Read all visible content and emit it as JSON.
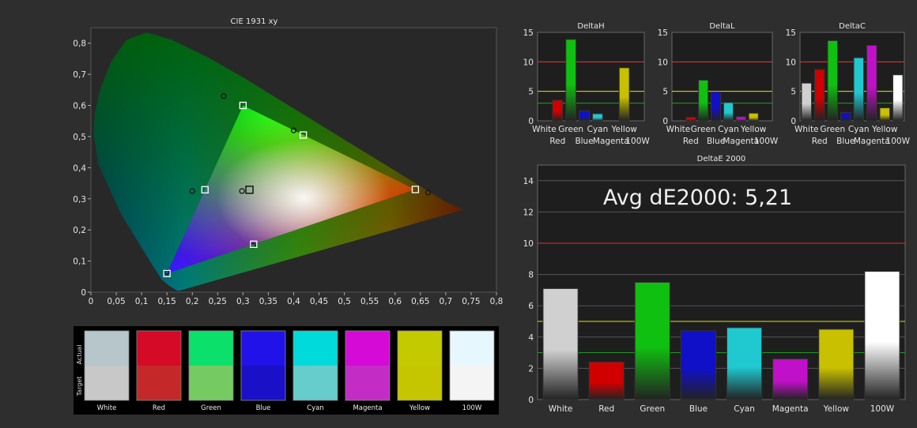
{
  "chart_data": [
    {
      "type": "scatter",
      "title": "CIE 1931 xy",
      "xlim": [
        0,
        0.8
      ],
      "ylim": [
        0,
        0.85
      ],
      "x_ticks": [
        "0",
        "0,05",
        "0,1",
        "0,15",
        "0,2",
        "0,25",
        "0,3",
        "0,35",
        "0,4",
        "0,45",
        "0,5",
        "0,55",
        "0,6",
        "0,65",
        "0,7",
        "0,75",
        "0,8"
      ],
      "y_ticks": [
        "0",
        "0,1",
        "0,2",
        "0,3",
        "0,4",
        "0,5",
        "0,6",
        "0,7",
        "0,8"
      ],
      "gamut_target": [
        [
          0.64,
          0.33
        ],
        [
          0.3,
          0.6
        ],
        [
          0.15,
          0.06
        ]
      ],
      "targets": [
        {
          "x": 0.3127,
          "y": 0.329
        },
        {
          "x": 0.64,
          "y": 0.33
        },
        {
          "x": 0.3,
          "y": 0.6
        },
        {
          "x": 0.15,
          "y": 0.06
        },
        {
          "x": 0.225,
          "y": 0.329
        },
        {
          "x": 0.321,
          "y": 0.154
        },
        {
          "x": 0.419,
          "y": 0.505
        }
      ],
      "measured": [
        {
          "x": 0.298,
          "y": 0.325
        },
        {
          "x": 0.665,
          "y": 0.32
        },
        {
          "x": 0.262,
          "y": 0.63
        },
        {
          "x": 0.15,
          "y": 0.065
        },
        {
          "x": 0.2,
          "y": 0.325
        },
        {
          "x": 0.32,
          "y": 0.15
        },
        {
          "x": 0.4,
          "y": 0.52
        }
      ]
    },
    {
      "type": "bar",
      "title": "DeltaH",
      "categories": [
        "White",
        "Red",
        "Green",
        "Blue",
        "Cyan",
        "Magenta",
        "Yellow",
        "100W"
      ],
      "values": [
        0,
        3.5,
        13.8,
        1.7,
        1.2,
        0,
        9.0,
        0
      ],
      "ylim": [
        0,
        15
      ],
      "y_ticks": [
        0,
        5,
        10,
        15
      ],
      "thresholds": [
        10,
        5,
        3
      ]
    },
    {
      "type": "bar",
      "title": "DeltaL",
      "categories": [
        "White",
        "Red",
        "Green",
        "Blue",
        "Cyan",
        "Magenta",
        "Yellow",
        "100W"
      ],
      "values": [
        0,
        0.6,
        6.9,
        4.9,
        3.1,
        0.7,
        1.3,
        0
      ],
      "ylim": [
        0,
        15
      ],
      "y_ticks": [
        0,
        5,
        10,
        15
      ],
      "thresholds": [
        10,
        5,
        3
      ]
    },
    {
      "type": "bar",
      "title": "DeltaC",
      "categories": [
        "White",
        "Red",
        "Green",
        "Blue",
        "Cyan",
        "Magenta",
        "Yellow",
        "100W"
      ],
      "values": [
        6.4,
        8.7,
        13.6,
        1.4,
        10.7,
        12.8,
        2.2,
        7.8
      ],
      "ylim": [
        0,
        15
      ],
      "y_ticks": [
        0,
        5,
        10,
        15
      ],
      "thresholds": [
        10,
        5,
        3
      ]
    },
    {
      "type": "bar",
      "title": "DeltaE 2000",
      "annotation": "Avg dE2000: 5,21",
      "categories": [
        "White",
        "Red",
        "Green",
        "Blue",
        "Cyan",
        "Magenta",
        "Yellow",
        "100W"
      ],
      "values": [
        7.1,
        2.4,
        7.5,
        4.4,
        4.6,
        2.6,
        4.5,
        8.2
      ],
      "ylim": [
        0,
        15
      ],
      "y_ticks": [
        0,
        2,
        4,
        6,
        8,
        10,
        12,
        14
      ],
      "thresholds": [
        10,
        5,
        3
      ]
    }
  ],
  "colors": {
    "White": "#d0d0d0",
    "Red": "#d00000",
    "Green": "#10c010",
    "Blue": "#1010c8",
    "Cyan": "#20c8d0",
    "Magenta": "#c010c8",
    "Yellow": "#c8c000",
    "100W": "#ffffff",
    "threshold_red": "#e03030",
    "threshold_yellow": "#e0e000",
    "threshold_green": "#20a020"
  },
  "swatches": {
    "actual_label": "Actual",
    "target_label": "Target",
    "items": [
      {
        "name": "White",
        "actual": "#b6c6ca",
        "target": "#c8c8c8"
      },
      {
        "name": "Red",
        "actual": "#d40a26",
        "target": "#c42828"
      },
      {
        "name": "Green",
        "actual": "#0ae06a",
        "target": "#76ca62"
      },
      {
        "name": "Blue",
        "actual": "#2212ea",
        "target": "#1a10c8"
      },
      {
        "name": "Cyan",
        "actual": "#00dada",
        "target": "#66cccc"
      },
      {
        "name": "Magenta",
        "actual": "#d60ad6",
        "target": "#c42cc6"
      },
      {
        "name": "Yellow",
        "actual": "#c4ca00",
        "target": "#c6c600"
      },
      {
        "name": "100W",
        "actual": "#e6f8fe",
        "target": "#f4f4f4"
      }
    ]
  }
}
